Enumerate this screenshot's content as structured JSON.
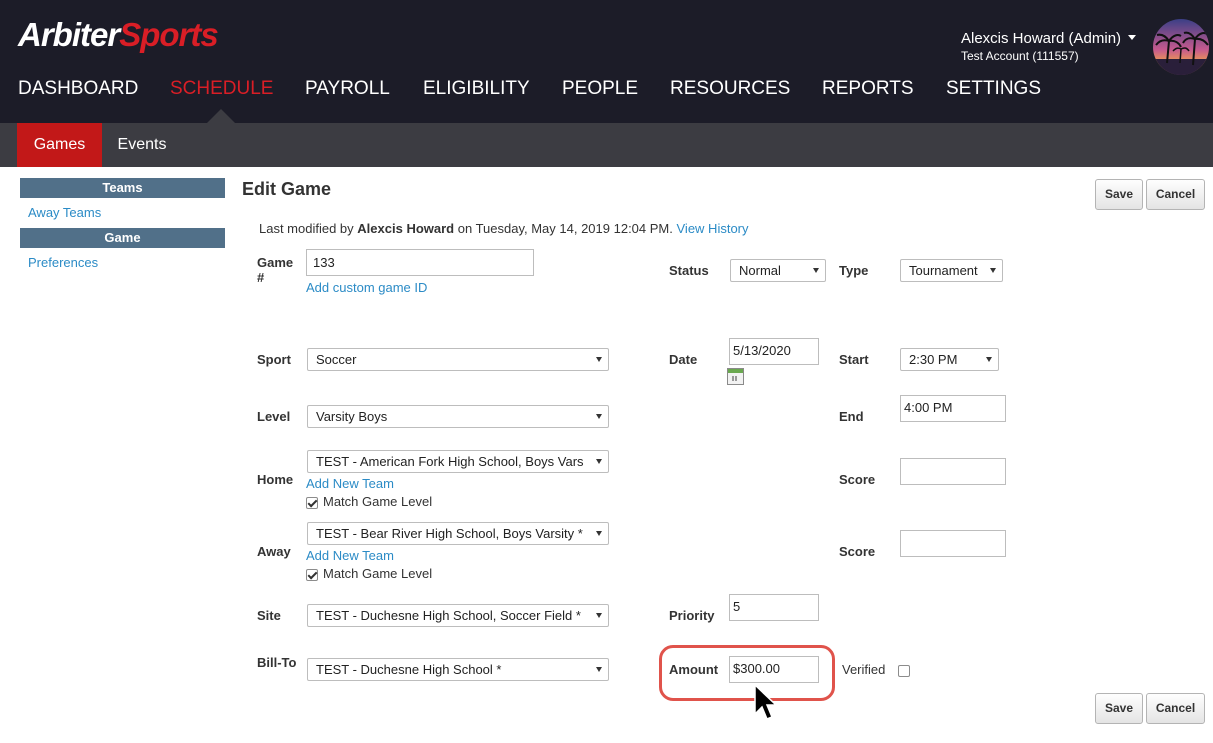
{
  "brand": {
    "part1": "Arbiter",
    "part2": "Sports"
  },
  "user": {
    "name": "Alexcis Howard (Admin)",
    "account": "Test Account (111557)"
  },
  "nav": [
    "DASHBOARD",
    "SCHEDULE",
    "PAYROLL",
    "ELIGIBILITY",
    "PEOPLE",
    "RESOURCES",
    "REPORTS",
    "SETTINGS"
  ],
  "nav_active": "SCHEDULE",
  "subnav": {
    "games": "Games",
    "events": "Events"
  },
  "sidebar": {
    "teams_header": "Teams",
    "away_teams": "Away Teams",
    "game_header": "Game",
    "preferences": "Preferences"
  },
  "page": {
    "title": "Edit Game",
    "save": "Save",
    "cancel": "Cancel"
  },
  "modified": {
    "prefix": "Last modified by",
    "user": "Alexcis Howard",
    "on_text": "on Tuesday, May 14, 2019 12:04 PM.",
    "view_history": "View History"
  },
  "form": {
    "game_label": "Game #",
    "game_value": "133",
    "add_custom_id": "Add custom game ID",
    "status_label": "Status",
    "status_value": "Normal",
    "type_label": "Type",
    "type_value": "Tournament",
    "sport_label": "Sport",
    "sport_value": "Soccer",
    "date_label": "Date",
    "date_value": "5/13/2020",
    "start_label": "Start",
    "start_value": "2:30 PM",
    "level_label": "Level",
    "level_value": "Varsity Boys",
    "end_label": "End",
    "end_value": "4:00 PM",
    "home_label": "Home",
    "home_value": "TEST - American Fork High School, Boys Vars",
    "add_new_team": "Add New Team",
    "match_game_level": "Match Game Level",
    "score_label": "Score",
    "away_label": "Away",
    "away_value": "TEST - Bear River High School, Boys Varsity *",
    "site_label": "Site",
    "site_value": "TEST - Duchesne High School, Soccer Field *",
    "priority_label": "Priority",
    "priority_value": "5",
    "billto_label": "Bill-To",
    "billto_value": "TEST - Duchesne High School *",
    "amount_label": "Amount",
    "amount_value": "$300.00",
    "verified_label": "Verified"
  },
  "colors": {
    "brand_red": "#d91e26",
    "topbar": "#1c1c28",
    "subbar": "#3c3c42",
    "active_tab": "#c21818",
    "side_header": "#517089",
    "link": "#2b8bc6",
    "highlight": "#e0534b"
  },
  "icons": [
    "calendar-icon",
    "mouse-cursor-icon",
    "caret-down-icon"
  ]
}
